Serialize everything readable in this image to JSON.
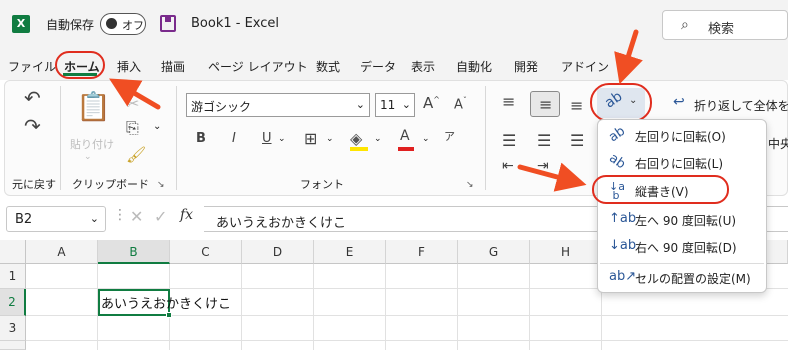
{
  "app": {
    "autosave_label": "自動保存",
    "autosave_state": "オフ",
    "doc_title": "Book1  -  Excel",
    "search_placeholder": "検索",
    "excel_icon_letter": "X"
  },
  "menu": {
    "tabs": [
      "ファイル",
      "ホーム",
      "挿入",
      "描画",
      "ページ レイアウト",
      "数式",
      "データ",
      "表示",
      "自動化",
      "開発",
      "アドイン"
    ]
  },
  "ribbon": {
    "undo_group_label": "元に戻す",
    "paste_label": "貼り付け",
    "clipboard_group_label": "クリップボード",
    "font_name": "游ゴシック",
    "font_size": "11",
    "font_group_label": "フォント",
    "bold": "B",
    "wrap_text_label": "折り返して全体を表",
    "merge_center_partial": "中央"
  },
  "formula_bar": {
    "name_box": "B2",
    "fx": "fx",
    "value": "あいうえおかきくけこ"
  },
  "grid": {
    "columns": [
      "A",
      "B",
      "C",
      "D",
      "E",
      "F",
      "G",
      "H"
    ],
    "rows": [
      "1",
      "2",
      "3"
    ],
    "cell_b2": "あいうえおかきくけこ"
  },
  "orientation_menu": {
    "items": [
      {
        "icon": "rotate-ccw-text-icon",
        "label": "左回りに回転(O)"
      },
      {
        "icon": "rotate-cw-text-icon",
        "label": "右回りに回転(L)"
      },
      {
        "icon": "vertical-text-icon",
        "label": "縦書き(V)"
      },
      {
        "icon": "rotate-up-text-icon",
        "label": "左へ 90 度回転(U)"
      },
      {
        "icon": "rotate-down-text-icon",
        "label": "右へ 90 度回転(D)"
      },
      {
        "icon": "format-alignment-icon",
        "label": "セルの配置の設定(M)"
      }
    ]
  },
  "colors": {
    "excel_green": "#107c41",
    "annotation_red": "#e02d1e",
    "annotation_arrow": "#f04e23"
  }
}
